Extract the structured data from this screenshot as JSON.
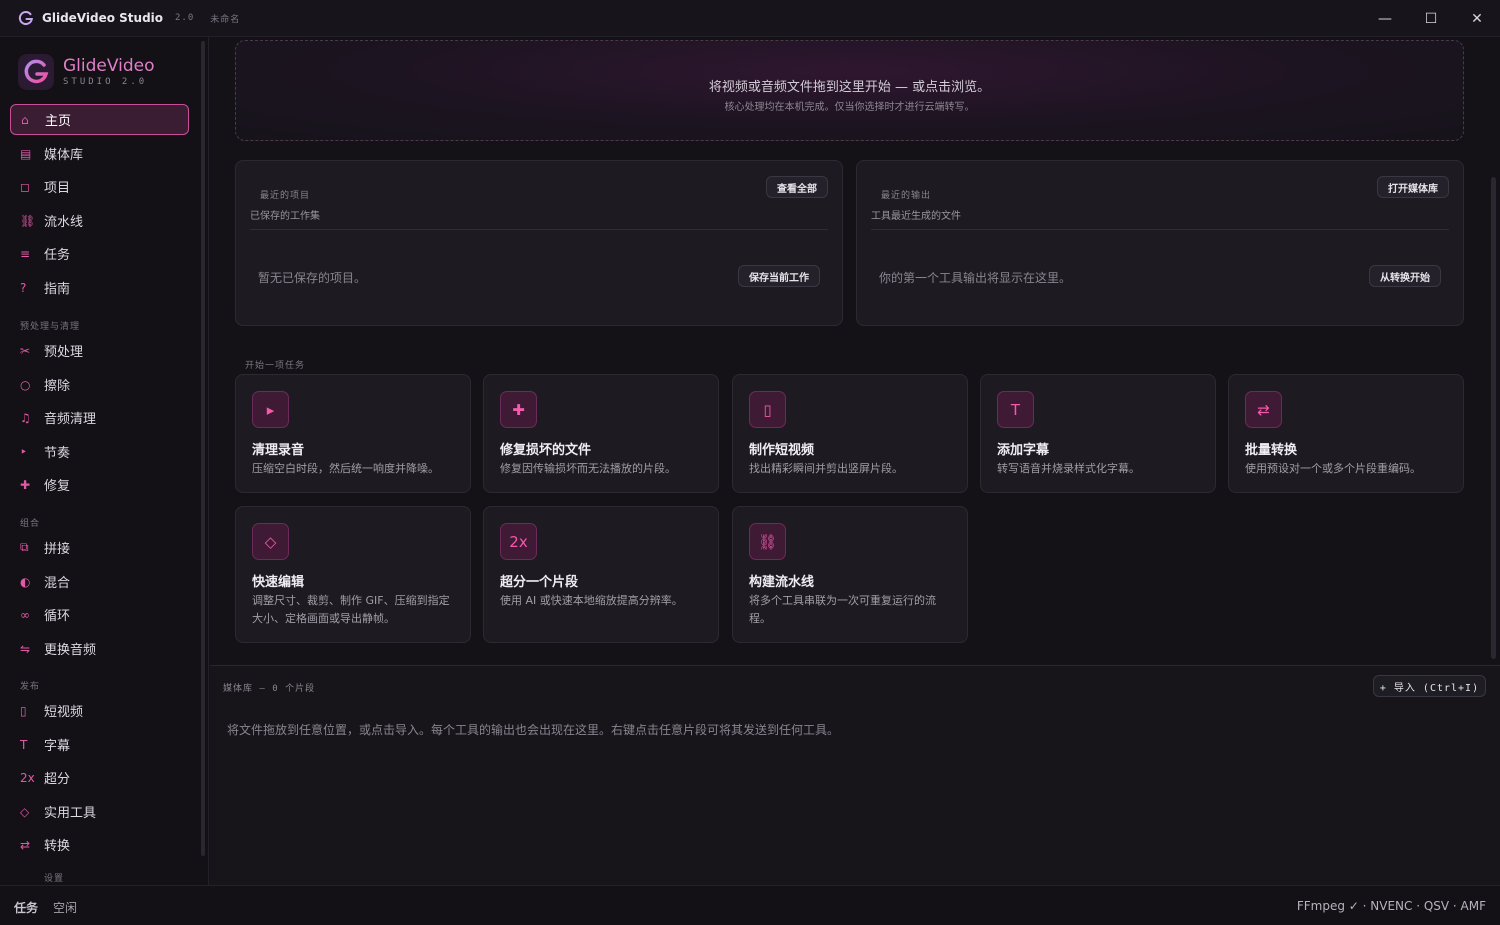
{
  "titlebar": {
    "app_name": "GlideVideo Studio",
    "version": "2.0",
    "doc_state": "未命名"
  },
  "window_controls": {
    "minimize": "—",
    "maximize": "☐",
    "close": "✕"
  },
  "brand": {
    "name": "GlideVideo",
    "subtitle": "STUDIO 2.0",
    "accent": "#e07fc8"
  },
  "sidebar": {
    "main_items": [
      {
        "label": "主页",
        "icon": "⌂",
        "icon_name": "home-icon",
        "active": true
      },
      {
        "label": "媒体库",
        "icon": "▤",
        "icon_name": "library-icon"
      },
      {
        "label": "项目",
        "icon": "◻",
        "icon_name": "project-icon"
      },
      {
        "label": "流水线",
        "icon": "⛓",
        "icon_name": "pipeline-icon"
      },
      {
        "label": "任务",
        "icon": "≡",
        "icon_name": "tasks-icon"
      },
      {
        "label": "指南",
        "icon": "?",
        "icon_name": "guide-icon"
      }
    ],
    "group_prep": "预处理与清理",
    "prep_items": [
      {
        "label": "预处理",
        "icon": "✂",
        "icon_name": "scissors-icon"
      },
      {
        "label": "擦除",
        "icon": "○",
        "icon_name": "erase-icon"
      },
      {
        "label": "音频清理",
        "icon": "♫",
        "icon_name": "music-note-icon"
      },
      {
        "label": "节奏",
        "icon": "‣",
        "icon_name": "rhythm-icon"
      },
      {
        "label": "修复",
        "icon": "✚",
        "icon_name": "repair-icon"
      }
    ],
    "group_combine": "组合",
    "combine_items": [
      {
        "label": "拼接",
        "icon": "⧉",
        "icon_name": "concat-icon"
      },
      {
        "label": "混合",
        "icon": "◐",
        "icon_name": "mix-icon"
      },
      {
        "label": "循环",
        "icon": "∞",
        "icon_name": "loop-icon"
      },
      {
        "label": "更换音频",
        "icon": "⇋",
        "icon_name": "swap-audio-icon"
      }
    ],
    "group_publish": "发布",
    "publish_items": [
      {
        "label": "短视频",
        "icon": "▯",
        "icon_name": "phone-icon"
      },
      {
        "label": "字幕",
        "icon": "T",
        "icon_name": "text-icon"
      },
      {
        "label": "超分",
        "icon": "2x",
        "icon_name": "upscale-icon"
      },
      {
        "label": "实用工具",
        "icon": "◇",
        "icon_name": "diamond-icon"
      },
      {
        "label": "转换",
        "icon": "⇄",
        "icon_name": "convert-icon"
      }
    ],
    "group_cutoff": "设置"
  },
  "dropzone": {
    "main": "将视频或音频文件拖到这里开始 — 或点击浏览。",
    "sub": "核心处理均在本机完成。仅当你选择时才进行云端转写。"
  },
  "recent_projects": {
    "kicker": "最近的项目",
    "subtitle": "已保存的工作集",
    "view_all": "查看全部",
    "empty": "暂无已保存的项目。",
    "action": "保存当前工作"
  },
  "recent_outputs": {
    "kicker": "最近的输出",
    "subtitle": "工具最近生成的文件",
    "open_library": "打开媒体库",
    "empty": "你的第一个工具输出将显示在这里。",
    "action": "从转换开始"
  },
  "tasks_section_label": "开始一项任务",
  "task_cards": [
    {
      "title": "清理录音",
      "desc": "压缩空白时段，然后统一响度并降噪。",
      "icon": "▸",
      "icon_name": "play-icon"
    },
    {
      "title": "修复损坏的文件",
      "desc": "修复因传输损坏而无法播放的片段。",
      "icon": "✚",
      "icon_name": "plus-icon"
    },
    {
      "title": "制作短视频",
      "desc": "找出精彩瞬间并剪出竖屏片段。",
      "icon": "▯",
      "icon_name": "phone-icon"
    },
    {
      "title": "添加字幕",
      "desc": "转写语音并烧录样式化字幕。",
      "icon": "T",
      "icon_name": "text-icon"
    },
    {
      "title": "批量转换",
      "desc": "使用预设对一个或多个片段重编码。",
      "icon": "⇄",
      "icon_name": "convert-icon"
    },
    {
      "title": "快速编辑",
      "desc": "调整尺寸、裁剪、制作 GIF、压缩到指定大小、定格画面或导出静帧。",
      "icon": "◇",
      "icon_name": "diamond-icon"
    },
    {
      "title": "超分一个片段",
      "desc": "使用 AI 或快速本地缩放提高分辨率。",
      "icon": "2x",
      "icon_name": "upscale-icon"
    },
    {
      "title": "构建流水线",
      "desc": "将多个工具串联为一次可重复运行的流程。",
      "icon": "⛓",
      "icon_name": "pipeline-icon"
    }
  ],
  "media_library": {
    "label": "媒体库 — 0 个片段",
    "import": "+ 导入 (Ctrl+I)",
    "hint": "将文件拖放到任意位置，或点击导入。每个工具的输出也会出现在这里。右键点击任意片段可将其发送到任何工具。"
  },
  "statusbar": {
    "label": "任务",
    "value": "空闲",
    "backends": "FFmpeg ✓ · NVENC · QSV · AMF"
  }
}
